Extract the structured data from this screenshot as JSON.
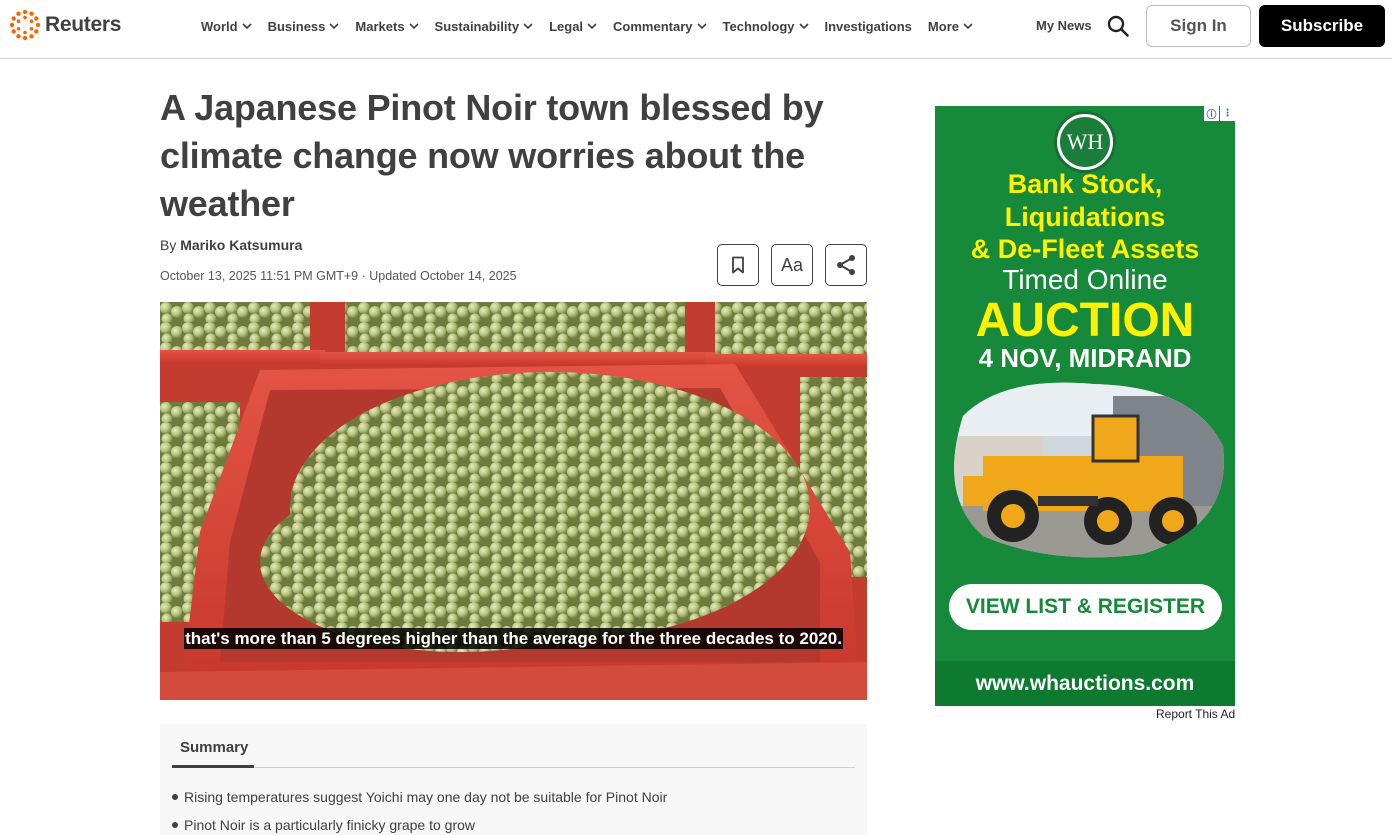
{
  "brand": {
    "name": "Reuters",
    "accent": "#fa6400"
  },
  "nav": {
    "items": [
      {
        "label": "World",
        "dropdown": true
      },
      {
        "label": "Business",
        "dropdown": true
      },
      {
        "label": "Markets",
        "dropdown": true
      },
      {
        "label": "Sustainability",
        "dropdown": true
      },
      {
        "label": "Legal",
        "dropdown": true
      },
      {
        "label": "Commentary",
        "dropdown": true
      },
      {
        "label": "Technology",
        "dropdown": true
      },
      {
        "label": "Investigations",
        "dropdown": false
      },
      {
        "label": "More",
        "dropdown": true
      }
    ],
    "my_news": "My News",
    "sign_in": "Sign In",
    "subscribe": "Subscribe"
  },
  "article": {
    "headline": "A Japanese Pinot Noir town blessed by climate change now worries about the weather",
    "byline_prefix": "By",
    "author": "Mariko Katsumura",
    "dateline": "October 13, 2025 11:51 PM GMT+9 · Updated October 14, 2025",
    "tools": {
      "font_label": "Aa"
    },
    "video_caption": "that's more than 5 degrees higher than the average for the three decades to 2020.",
    "summary": {
      "tab_label": "Summary",
      "items": [
        "Rising temperatures suggest Yoichi may one day not be suitable for Pinot Noir",
        "Pinot Noir is a particularly finicky grape to grow"
      ]
    }
  },
  "ad": {
    "logo_text": "WH",
    "line1": "Bank Stock,",
    "line2": "Liquidations",
    "line3": "& De-Fleet Assets",
    "line4": "Timed Online",
    "line5": "AUCTION",
    "line6": "4 NOV, MIDRAND",
    "cta": "VIEW LIST & REGISTER",
    "url": "www.whauctions.com",
    "report_label": "Report This Ad",
    "colors": {
      "background": "#16893a",
      "highlight": "#fff200"
    }
  }
}
